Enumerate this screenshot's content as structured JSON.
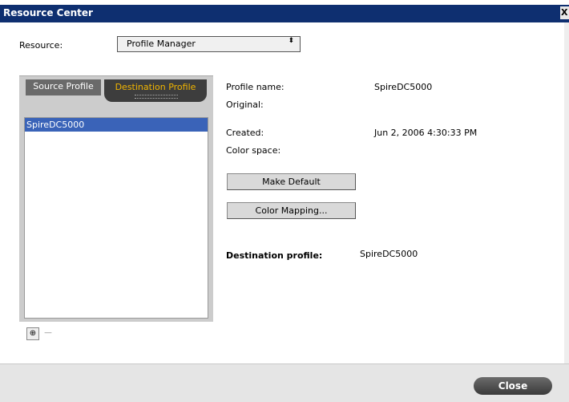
{
  "window": {
    "title": "Resource Center",
    "close_glyph": "X"
  },
  "resource": {
    "label": "Resource:",
    "selected": "Profile Manager",
    "arrow_icon": "⬍"
  },
  "tabs": [
    {
      "label": "Source Profile",
      "active": false
    },
    {
      "label": "Destination Profile",
      "active": true
    }
  ],
  "profiles": {
    "items": [
      "SpireDC5000"
    ],
    "selected": "SpireDC5000"
  },
  "list_buttons": {
    "add_glyph": "⊕",
    "remove_glyph": "−"
  },
  "details": {
    "profile_name_label": "Profile name:",
    "profile_name_value": "SpireDC5000",
    "original_label": "Original:",
    "original_value": "",
    "created_label": "Created:",
    "created_value": "Jun 2, 2006 4:30:33 PM",
    "color_space_label": "Color space:",
    "color_space_value": ""
  },
  "buttons": {
    "make_default": "Make Default",
    "color_mapping": "Color Mapping..."
  },
  "destination": {
    "label": "Destination profile:",
    "value": "SpireDC5000"
  },
  "footer": {
    "close_label": "Close"
  },
  "colors": {
    "titlebar": "#0e2f70",
    "selection": "#3a63b8",
    "active_tab_text": "#f0b400"
  }
}
